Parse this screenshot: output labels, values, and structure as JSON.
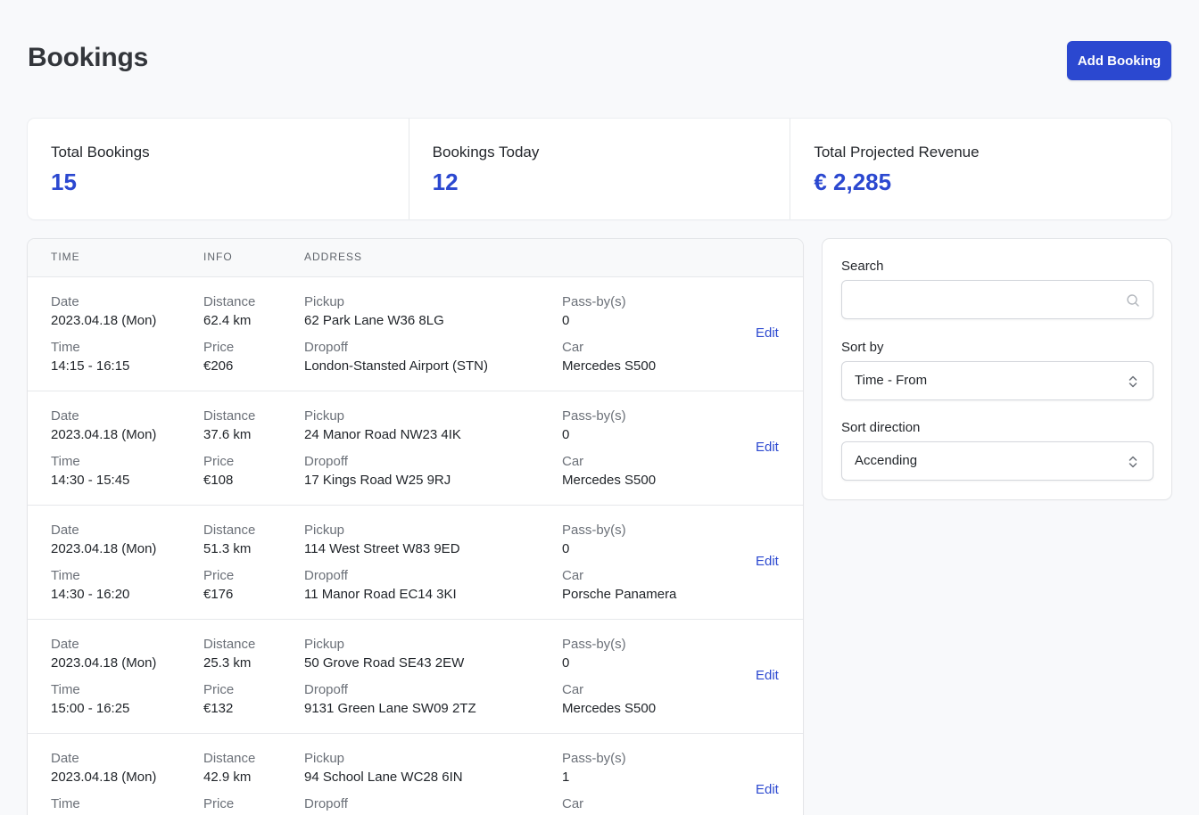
{
  "header": {
    "title": "Bookings",
    "add_button": "Add Booking"
  },
  "stats": [
    {
      "label": "Total Bookings",
      "value": "15"
    },
    {
      "label": "Bookings Today",
      "value": "12"
    },
    {
      "label": "Total Projected Revenue",
      "value": "€ 2,285"
    }
  ],
  "table": {
    "headers": {
      "time": "TIME",
      "info": "INFO",
      "address": "ADDRESS"
    },
    "labels": {
      "date": "Date",
      "time": "Time",
      "distance": "Distance",
      "price": "Price",
      "pickup": "Pickup",
      "dropoff": "Dropoff",
      "passby": "Pass-by(s)",
      "car": "Car",
      "edit": "Edit"
    },
    "rows": [
      {
        "date": "2023.04.18 (Mon)",
        "time": "14:15 - 16:15",
        "distance": "62.4 km",
        "price": "€206",
        "pickup": "62 Park Lane W36 8LG",
        "dropoff": "London-Stansted Airport (STN)",
        "passby": "0",
        "car": "Mercedes S500"
      },
      {
        "date": "2023.04.18 (Mon)",
        "time": "14:30 - 15:45",
        "distance": "37.6 km",
        "price": "€108",
        "pickup": "24 Manor Road NW23 4IK",
        "dropoff": "17 Kings Road W25 9RJ",
        "passby": "0",
        "car": "Mercedes S500"
      },
      {
        "date": "2023.04.18 (Mon)",
        "time": "14:30 - 16:20",
        "distance": "51.3 km",
        "price": "€176",
        "pickup": "114 West Street W83 9ED",
        "dropoff": "11 Manor Road EC14 3KI",
        "passby": "0",
        "car": "Porsche Panamera"
      },
      {
        "date": "2023.04.18 (Mon)",
        "time": "15:00 - 16:25",
        "distance": "25.3 km",
        "price": "€132",
        "pickup": "50 Grove Road SE43 2EW",
        "dropoff": "9131 Green Lane SW09 2TZ",
        "passby": "0",
        "car": "Mercedes S500"
      },
      {
        "date": "2023.04.18 (Mon)",
        "time": "",
        "distance": "42.9 km",
        "price": "",
        "pickup": "94 School Lane WC28 6IN",
        "dropoff": "",
        "passby": "1",
        "car": ""
      }
    ]
  },
  "filters": {
    "search_label": "Search",
    "search_value": "",
    "sort_by_label": "Sort by",
    "sort_by_value": "Time - From",
    "sort_direction_label": "Sort direction",
    "sort_direction_value": "Accending"
  },
  "icons": {
    "search": "search-icon",
    "select": "chevron-up-down-icon"
  },
  "colors": {
    "accent": "#2b48d0",
    "background": "#f8f9fb"
  }
}
